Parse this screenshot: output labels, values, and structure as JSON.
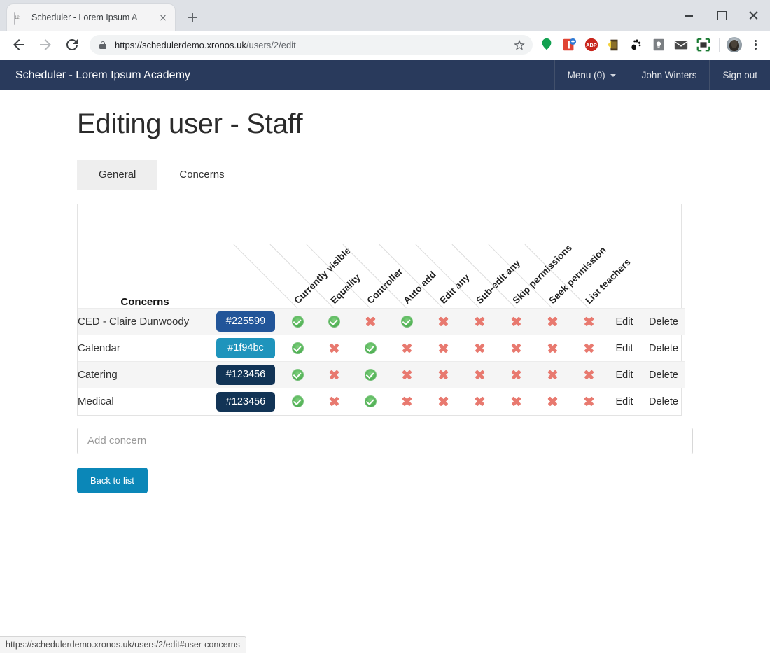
{
  "browser": {
    "tab": {
      "title": "Scheduler - Lorem Ipsum A",
      "favicon": "calendar-icon"
    },
    "newtab_label": "+",
    "url_secure": "https://schedulerdemo.xronos.uk",
    "url_path": "/users/2/edit",
    "window": {
      "minimize": "–",
      "maximize": "□",
      "close": "×"
    },
    "extensions": [
      "green-balloon-icon",
      "red-book-add-icon",
      "adblock-plus-icon",
      "yellow-house-icon",
      "gnome-foot-icon",
      "lightbulb-note-icon",
      "envelope-icon",
      "screenshot-frame-icon"
    ],
    "statusbar_url": "https://schedulerdemo.xronos.uk/users/2/edit#user-concerns"
  },
  "app": {
    "brand": "Scheduler - Lorem Ipsum Academy",
    "nav": [
      {
        "label": "Menu (0)",
        "has_caret": true
      },
      {
        "label": "John Winters",
        "has_caret": false
      },
      {
        "label": "Sign out",
        "has_caret": false
      }
    ],
    "page_title": "Editing user - Staff",
    "tabs": [
      {
        "label": "General",
        "active": true
      },
      {
        "label": "Concerns",
        "active": false
      }
    ],
    "table": {
      "row_header_label": "Concerns",
      "columns": [
        "Currently visible",
        "Equality",
        "Controller",
        "Auto add",
        "Edit any",
        "Sub-edit any",
        "Skip permissions",
        "Seek permission",
        "List teachers"
      ],
      "action_labels": {
        "edit": "Edit",
        "delete": "Delete"
      },
      "rows": [
        {
          "name": "CED - Claire Dunwoody",
          "colour": "#225599",
          "flags": [
            true,
            true,
            false,
            true,
            false,
            false,
            false,
            false,
            false
          ]
        },
        {
          "name": "Calendar",
          "colour": "#1f94bc",
          "flags": [
            true,
            false,
            true,
            false,
            false,
            false,
            false,
            false,
            false
          ]
        },
        {
          "name": "Catering",
          "colour": "#123456",
          "flags": [
            true,
            false,
            true,
            false,
            false,
            false,
            false,
            false,
            false
          ]
        },
        {
          "name": "Medical",
          "colour": "#123456",
          "flags": [
            true,
            false,
            true,
            false,
            false,
            false,
            false,
            false,
            false
          ]
        }
      ]
    },
    "add_concern_placeholder": "Add concern",
    "add_concern_value": "",
    "back_button": "Back to list"
  },
  "colors": {
    "navbar_bg": "#293a5c",
    "primary_button": "#0b87b8",
    "tick_green": "#52b255",
    "cross_red": "#e8796f"
  }
}
